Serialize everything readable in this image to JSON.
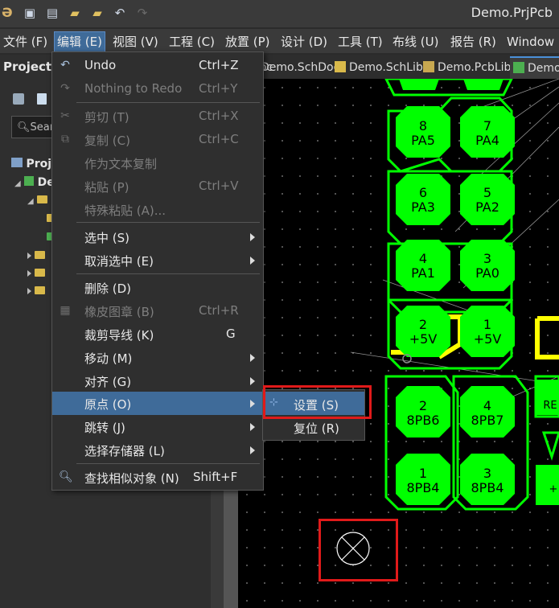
{
  "window": {
    "title": "Demo.PrjPcb"
  },
  "toolbar": {
    "icons": [
      "app-logo",
      "save-icon",
      "save-all-icon",
      "open-folder-icon",
      "open-project-icon",
      "undo-icon",
      "redo-icon"
    ]
  },
  "menubar": {
    "items": [
      "文件 (F)",
      "编辑 (E)",
      "视图 (V)",
      "工程 (C)",
      "放置 (P)",
      "设计 (D)",
      "工具 (T)",
      "布线 (U)",
      "报告 (R)",
      "Window"
    ],
    "active": "编辑 (E)"
  },
  "tabs": {
    "items": [
      ".SchDoc",
      "Demo.SchDoc",
      "Demo.SchLib",
      "Demo.PcbLib",
      "Demo."
    ],
    "active": "Demo."
  },
  "panel": {
    "title": "Projects",
    "search_placeholder": "Sear",
    "tree": {
      "project_label": "Proje",
      "demo_label": "De"
    }
  },
  "context_menu": {
    "items": [
      {
        "label": "Undo",
        "shortcut": "Ctrl+Z",
        "icon": "undo-icon",
        "enabled": true
      },
      {
        "label": "Nothing to Redo",
        "shortcut": "Ctrl+Y",
        "icon": "redo-icon",
        "enabled": false
      },
      {
        "label": "剪切 (T)",
        "shortcut": "Ctrl+X",
        "icon": "cut-icon",
        "enabled": false
      },
      {
        "label": "复制 (C)",
        "shortcut": "Ctrl+C",
        "icon": "copy-icon",
        "enabled": false
      },
      {
        "label": "作为文本复制",
        "shortcut": "",
        "icon": "",
        "enabled": false
      },
      {
        "label": "粘贴 (P)",
        "shortcut": "Ctrl+V",
        "icon": "",
        "enabled": false
      },
      {
        "label": "特殊粘贴 (A)...",
        "shortcut": "",
        "icon": "",
        "enabled": false
      },
      {
        "label": "选中 (S)",
        "shortcut": "",
        "icon": "",
        "enabled": true,
        "submenu": true
      },
      {
        "label": "取消选中 (E)",
        "shortcut": "",
        "icon": "",
        "enabled": true,
        "submenu": true
      },
      {
        "label": "删除 (D)",
        "shortcut": "",
        "icon": "",
        "enabled": true
      },
      {
        "label": "橡皮图章 (B)",
        "shortcut": "Ctrl+R",
        "icon": "stamp-icon",
        "enabled": false
      },
      {
        "label": "裁剪导线 (K)",
        "shortcut": "G",
        "icon": "",
        "enabled": true
      },
      {
        "label": "移动 (M)",
        "shortcut": "",
        "icon": "",
        "enabled": true,
        "submenu": true
      },
      {
        "label": "对齐 (G)",
        "shortcut": "",
        "icon": "",
        "enabled": true,
        "submenu": true
      },
      {
        "label": "原点 (O)",
        "shortcut": "",
        "icon": "",
        "enabled": true,
        "submenu": true,
        "highlighted": true
      },
      {
        "label": "跳转 (J)",
        "shortcut": "",
        "icon": "",
        "enabled": true,
        "submenu": true
      },
      {
        "label": "选择存储器 (L)",
        "shortcut": "",
        "icon": "",
        "enabled": true,
        "submenu": true
      },
      {
        "label": "查找相似对象 (N)",
        "shortcut": "Shift+F",
        "icon": "find-similar-icon",
        "enabled": true
      }
    ]
  },
  "submenu": {
    "items": [
      {
        "label": "设置 (S)",
        "icon": "origin-set-icon",
        "highlighted": true
      },
      {
        "label": "复位 (R)",
        "icon": "",
        "highlighted": false
      }
    ]
  },
  "pcb": {
    "pads": [
      {
        "num": "8",
        "name": "PA5"
      },
      {
        "num": "7",
        "name": "PA4"
      },
      {
        "num": "6",
        "name": "PA3"
      },
      {
        "num": "5",
        "name": "PA2"
      },
      {
        "num": "4",
        "name": "PA1"
      },
      {
        "num": "3",
        "name": "PA0"
      },
      {
        "num": "2",
        "name": "+5V"
      },
      {
        "num": "1",
        "name": "+5V"
      },
      {
        "num": "2",
        "name": "8PB6"
      },
      {
        "num": "4",
        "name": "8PB7"
      },
      {
        "num": "1",
        "name": "8PB4"
      },
      {
        "num": "3",
        "name": "8PB4"
      }
    ],
    "partial_labels": [
      "RE",
      "+"
    ],
    "colors": {
      "pad": "#00ff00",
      "silkscreen": "#ffff00",
      "background": "#000000",
      "highlight_box": "#e01a1a"
    }
  }
}
